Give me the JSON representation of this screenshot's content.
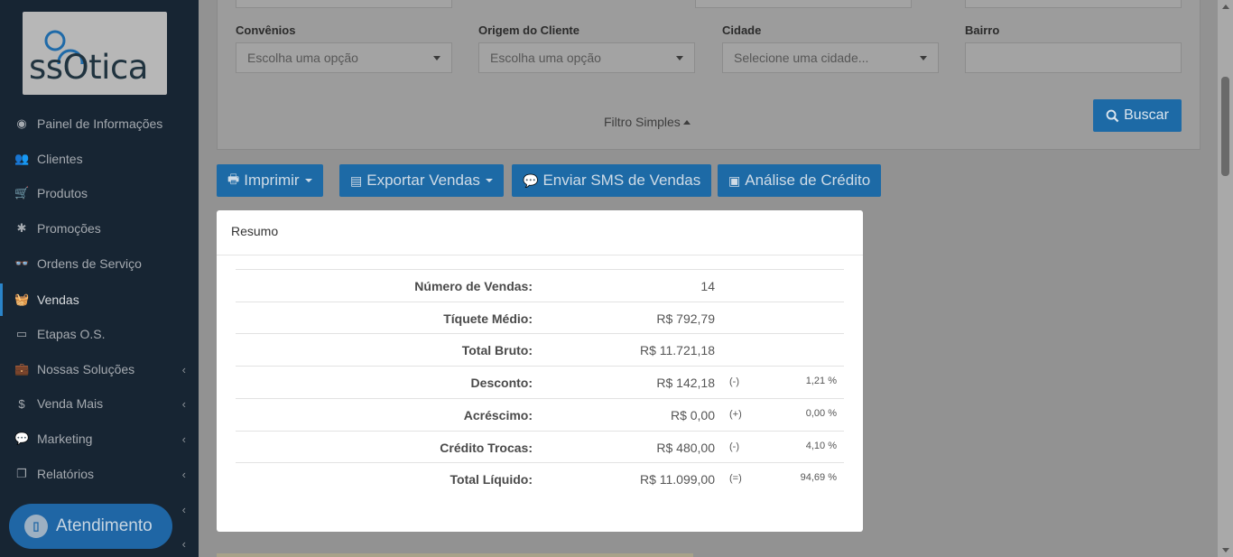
{
  "brand": {
    "logo_text": "ssOtica"
  },
  "sidebar": {
    "items": [
      {
        "label": "Painel de Informações",
        "icon": "dashboard-icon",
        "glyph": "◉"
      },
      {
        "label": "Clientes",
        "icon": "users-icon",
        "glyph": "👥"
      },
      {
        "label": "Produtos",
        "icon": "cart-icon",
        "glyph": "🛒"
      },
      {
        "label": "Promoções",
        "icon": "asterisk-icon",
        "glyph": "✱"
      },
      {
        "label": "Ordens de Serviço",
        "icon": "glasses-icon",
        "glyph": "👓"
      },
      {
        "label": "Vendas",
        "icon": "basket-icon",
        "glyph": "🧺"
      },
      {
        "label": "Etapas O.S.",
        "icon": "ticket-icon",
        "glyph": "▭"
      },
      {
        "label": "Nossas Soluções",
        "icon": "briefcase-icon",
        "glyph": "💼"
      },
      {
        "label": "Venda Mais",
        "icon": "dollar-icon",
        "glyph": "$"
      },
      {
        "label": "Marketing",
        "icon": "comments-icon",
        "glyph": "💬"
      },
      {
        "label": "Relatórios",
        "icon": "copy-icon",
        "glyph": "❐"
      }
    ]
  },
  "atendimento": {
    "label": "Atendimento"
  },
  "filters": {
    "convenios": {
      "label": "Convênios",
      "value": "Escolha uma opção"
    },
    "origem": {
      "label": "Origem do Cliente",
      "value": "Escolha uma opção"
    },
    "cidade": {
      "label": "Cidade",
      "value": "Selecione uma cidade..."
    },
    "bairro": {
      "label": "Bairro",
      "value": ""
    },
    "filtro_simples": "Filtro Simples",
    "buscar": "Buscar"
  },
  "actions": {
    "imprimir": "Imprimir",
    "exportar": "Exportar Vendas",
    "sms": "Enviar SMS de Vendas",
    "analise": "Análise de Crédito"
  },
  "resumo": {
    "title": "Resumo",
    "rows": [
      {
        "label": "Número de Vendas:",
        "value": "14",
        "sign": "",
        "pct": ""
      },
      {
        "label": "Tíquete Médio:",
        "value": "R$ 792,79",
        "sign": "",
        "pct": ""
      },
      {
        "label": "Total Bruto:",
        "value": "R$ 11.721,18",
        "sign": "",
        "pct": ""
      },
      {
        "label": "Desconto:",
        "value": "R$ 142,18",
        "sign": "(-)",
        "pct": "1,21 %"
      },
      {
        "label": "Acréscimo:",
        "value": "R$ 0,00",
        "sign": "(+)",
        "pct": "0,00 %"
      },
      {
        "label": "Crédito Trocas:",
        "value": "R$ 480,00",
        "sign": "(-)",
        "pct": "4,10 %"
      },
      {
        "label": "Total Líquido:",
        "value": "R$ 11.099,00",
        "sign": "(=)",
        "pct": "94,69 %"
      }
    ]
  },
  "colors": {
    "primary": "#1d6aa6",
    "sidebar": "#172533",
    "overlay": "#929292"
  }
}
